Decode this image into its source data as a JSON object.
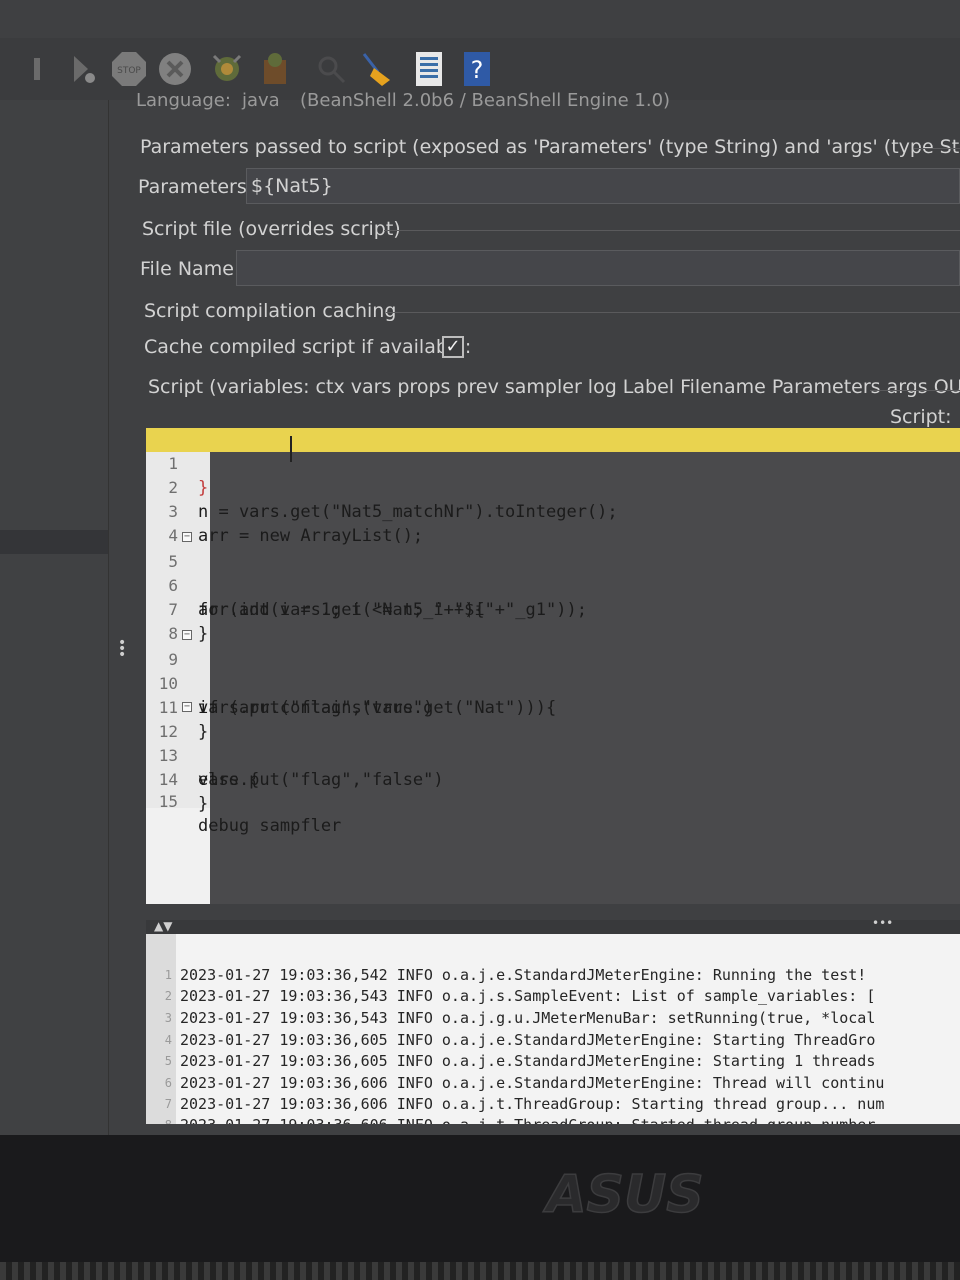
{
  "panel": {
    "language_label": "Language:",
    "language_value": "java",
    "engine_info": "(BeanShell 2.0b6 / BeanShell Engine 1.0)",
    "params_heading": "Parameters passed to script (exposed as 'Parameters' (type String) and 'args' (type String[]))",
    "params_label": "Parameters:",
    "params_value": "${Nat5}",
    "script_file_heading": "Script file (overrides script)",
    "file_name_label": "File Name:",
    "file_name_value": "",
    "caching_heading": "Script compilation caching",
    "cache_label": "Cache compiled script if available:",
    "cache_checked": true,
    "script_heading": "Script (variables: ctx vars props prev sampler log Label Filename Parameters args OUT)",
    "script_label": "Script:"
  },
  "editor": {
    "lines": [
      {
        "n": "1",
        "text": "}"
      },
      {
        "n": "2",
        "text": "n = vars.get(\"Nat5_matchNr\").toInteger();"
      },
      {
        "n": "3",
        "text": "arr = new ArrayList();"
      },
      {
        "n": "4",
        "text": ""
      },
      {
        "n": "5",
        "text": "for(int i = 1; i <= n; i++){"
      },
      {
        "n": "6",
        "text": "arr.add(vars.get(\"Nat5_\"+\"$i\"+\"_g1\"));"
      },
      {
        "n": "7",
        "text": "}"
      },
      {
        "n": "8",
        "text": ""
      },
      {
        "n": "9",
        "text": "if (arr.contains(vars.get(\"Nat\"))){"
      },
      {
        "n": "10",
        "text": "vars.put(\"flag\",\"true\")"
      },
      {
        "n": "11",
        "text": "}"
      },
      {
        "n": "12",
        "text": "else {"
      },
      {
        "n": "13",
        "text": "vars.put(\"flag\",\"false\")"
      },
      {
        "n": "14",
        "text": "}"
      },
      {
        "n": "15",
        "text": "debug sampfler"
      }
    ]
  },
  "log": {
    "lines": [
      {
        "n": "1",
        "text": "2023-01-27 19:03:36,542 INFO o.a.j.e.StandardJMeterEngine: Running the test!"
      },
      {
        "n": "2",
        "text": "2023-01-27 19:03:36,543 INFO o.a.j.s.SampleEvent: List of sample_variables: ["
      },
      {
        "n": "3",
        "text": "2023-01-27 19:03:36,543 INFO o.a.j.g.u.JMeterMenuBar: setRunning(true, *local"
      },
      {
        "n": "4",
        "text": "2023-01-27 19:03:36,605 INFO o.a.j.e.StandardJMeterEngine: Starting ThreadGro"
      },
      {
        "n": "5",
        "text": "2023-01-27 19:03:36,605 INFO o.a.j.e.StandardJMeterEngine: Starting 1 threads"
      },
      {
        "n": "6",
        "text": "2023-01-27 19:03:36,606 INFO o.a.j.e.StandardJMeterEngine: Thread will continu"
      },
      {
        "n": "7",
        "text": "2023-01-27 19:03:36,606 INFO o.a.j.t.ThreadGroup: Starting thread group... num"
      },
      {
        "n": "8",
        "text": "2023-01-27 19:03:36,606 INFO o.a.j.t.ThreadGroup: Started thread group number"
      }
    ]
  },
  "toolbar": {
    "icons": [
      "play-no-pauses-icon",
      "play-remote-icon",
      "stop-icon",
      "shutdown-icon",
      "clear-icon",
      "clear-all-icon",
      "search-icon",
      "reset-search-icon",
      "function-helper-icon",
      "help-icon"
    ],
    "stop_text": "STOP"
  },
  "laptop": {
    "brand": "ASUS"
  }
}
